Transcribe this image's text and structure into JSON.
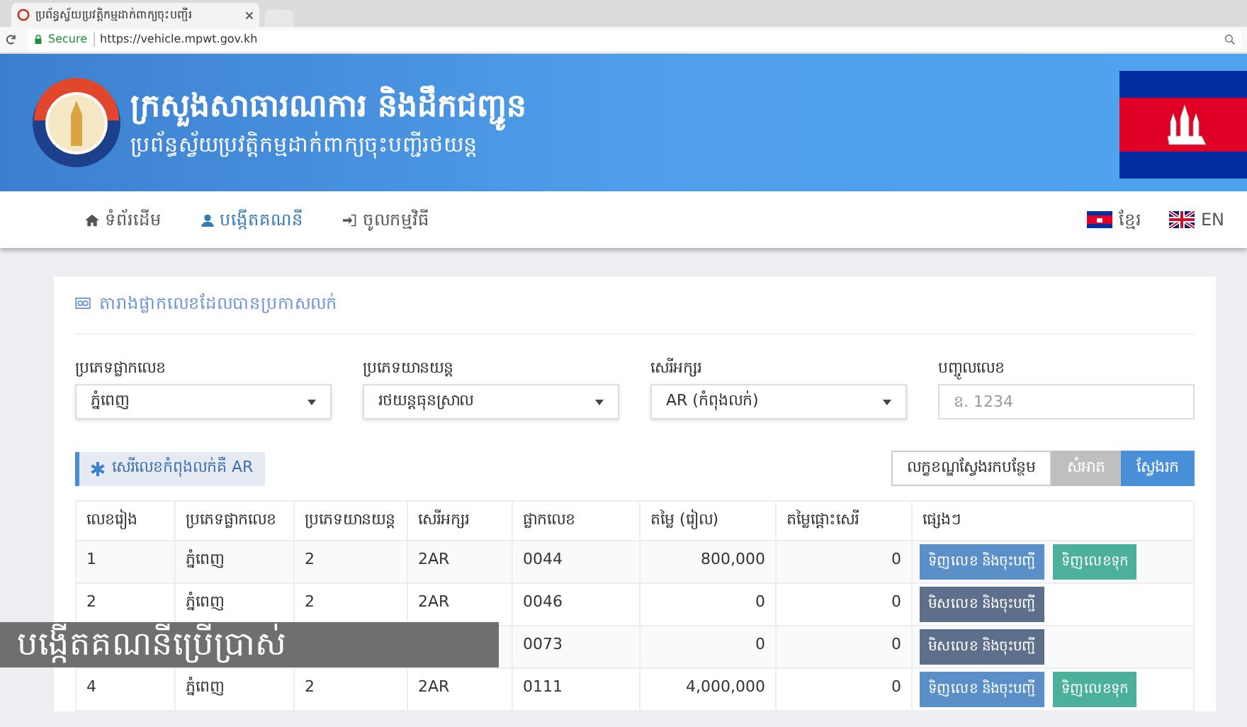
{
  "browser": {
    "tab_title": "ប្រព័ន្ធស្វ័យប្រវត្តិកម្មដាក់ពាក្យចុះបញ្ជីរ",
    "secure_label": "Secure",
    "url": "https://vehicle.mpwt.gov.kh"
  },
  "header": {
    "title": "ក្រសួងសាធារណការ និងដឹកជញ្ជូន",
    "subtitle": "ប្រព័ន្ធស្វ័យប្រវត្តិកម្មដាក់ពាក្យចុះបញ្ជីរថយន្ត"
  },
  "nav": {
    "items": [
      {
        "kind": "home",
        "label": "ទំព័រដើម",
        "selected": false
      },
      {
        "kind": "user",
        "label": "បង្កើតគណនី",
        "selected": true
      },
      {
        "kind": "login",
        "label": "ចូលកម្មវិធី",
        "selected": false
      }
    ],
    "languages": [
      {
        "kind": "km",
        "label": "ខ្មែរ"
      },
      {
        "kind": "en",
        "label": "EN"
      }
    ]
  },
  "panel": {
    "title": "តារាងផ្លាកលេខដែលបានប្រកាសលក់",
    "filters": [
      {
        "kind": "select",
        "label": "ប្រភេទផ្លាកលេខ",
        "value": "ភ្នំពេញ"
      },
      {
        "kind": "select",
        "label": "ប្រភេទយានយន្ត",
        "value": "រថយន្តធុនស្រាល"
      },
      {
        "kind": "select",
        "label": "សេរីអក្សរ",
        "value": "AR (កំពុងលក់)"
      },
      {
        "kind": "input",
        "label": "បញ្ចូលលេខ",
        "placeholder": "ឧ. 1234"
      }
    ],
    "notice": "សេរីលេខកំពុងលក់គឺ AR",
    "buttons": [
      {
        "kind": "outline",
        "label": "លក្ខខណ្ឌស្វែងរកបន្ថែម"
      },
      {
        "kind": "muted",
        "label": "សំអាត"
      },
      {
        "kind": "primary",
        "label": "ស្វែងរក"
      }
    ]
  },
  "table": {
    "columns": [
      "លេខរៀង",
      "ប្រភេទផ្លាកលេខ",
      "ប្រភេទយានយន្ត",
      "សេរីអក្សរ",
      "ផ្លាកលេខ",
      "តម្លៃ (រៀល)",
      "តម្លៃផ្តោះសេរី",
      "ផ្សេងៗ"
    ],
    "rows": [
      {
        "cells": [
          "1",
          "ភ្នំពេញ",
          "2",
          "2AR",
          "0044",
          "800,000",
          "0"
        ],
        "actions": [
          {
            "kind": "buy",
            "label": "ទិញលេខ និងចុះបញ្ជី"
          },
          {
            "kind": "reserve",
            "label": "ទិញលេខទុក"
          }
        ]
      },
      {
        "cells": [
          "2",
          "ភ្នំពេញ",
          "2",
          "2AR",
          "0046",
          "0",
          "0"
        ],
        "actions": [
          {
            "kind": "other",
            "label": "មិសលេខ និងចុះបញ្ជី"
          }
        ]
      },
      {
        "cells": [
          null,
          null,
          null,
          null,
          "0073",
          "0",
          "0"
        ],
        "actions": [
          {
            "kind": "other",
            "label": "មិសលេខ និងចុះបញ្ជី"
          }
        ]
      },
      {
        "cells": [
          "4",
          "ភ្នំពេញ",
          "2",
          "2AR",
          "0111",
          "4,000,000",
          "0"
        ],
        "actions": [
          {
            "kind": "buy",
            "label": "ទិញលេខ និងចុះបញ្ជី"
          },
          {
            "kind": "reserve",
            "label": "ទិញលេខទុក"
          }
        ]
      }
    ]
  },
  "caption": "បង្កើតគណនីប្រើប្រាស់"
}
